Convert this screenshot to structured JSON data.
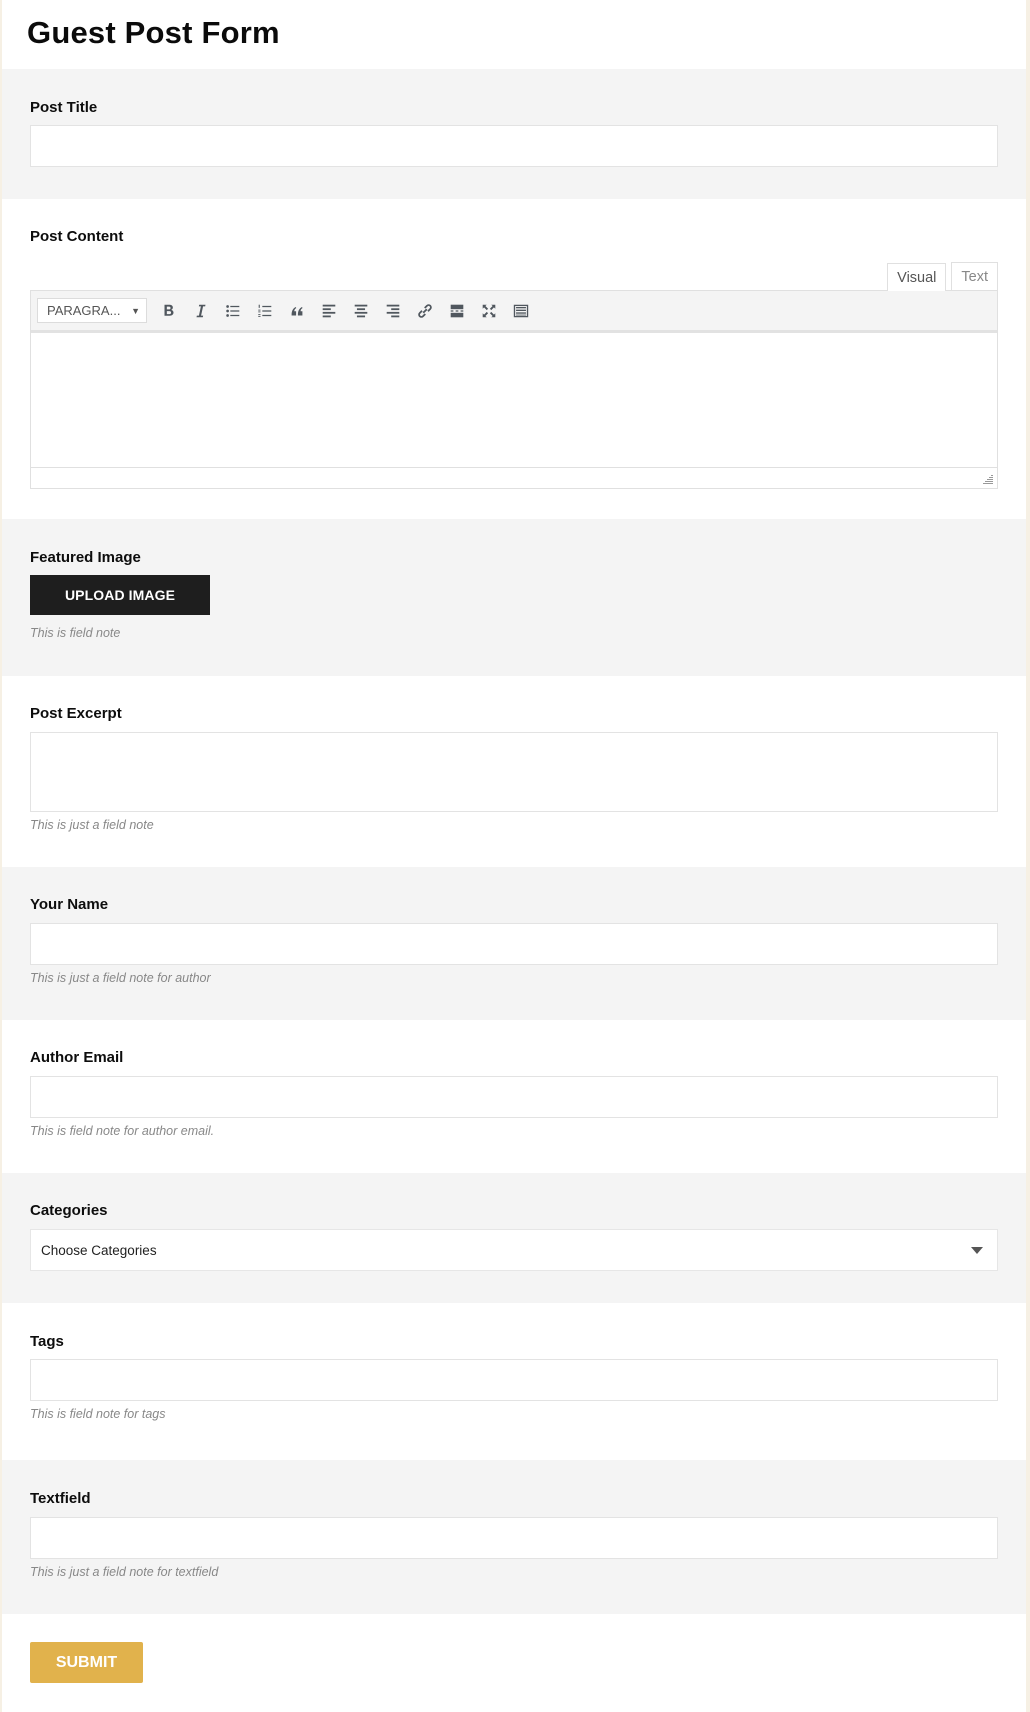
{
  "page": {
    "title": "Guest Post Form"
  },
  "colors": {
    "submit_bg": "#e1b24c",
    "upload_bg": "#1e1e1e",
    "section_alt_bg": "#f4f4f4",
    "side_strip": "#f6f0e4"
  },
  "fields": {
    "post_title": {
      "label": "Post Title",
      "value": "",
      "placeholder": ""
    },
    "post_content": {
      "label": "Post Content",
      "tabs": [
        {
          "label": "Visual",
          "active": true
        },
        {
          "label": "Text",
          "active": false
        }
      ],
      "format_select": "PARAGRA...",
      "toolbar_icons": [
        "bold-icon",
        "italic-icon",
        "bulleted-list-icon",
        "numbered-list-icon",
        "blockquote-icon",
        "align-left-icon",
        "align-center-icon",
        "align-right-icon",
        "link-icon",
        "read-more-icon",
        "fullscreen-icon",
        "toolbar-toggle-icon"
      ],
      "value": ""
    },
    "featured_image": {
      "label": "Featured Image",
      "button": "UPLOAD IMAGE",
      "note": "This is field note"
    },
    "post_excerpt": {
      "label": "Post Excerpt",
      "value": "",
      "note": "This is just a field note"
    },
    "your_name": {
      "label": "Your Name",
      "value": "",
      "note": "This is just a field note for author"
    },
    "author_email": {
      "label": "Author Email",
      "value": "",
      "note": "This is field note for author email."
    },
    "categories": {
      "label": "Categories",
      "selected": "Choose Categories"
    },
    "tags": {
      "label": "Tags",
      "value": "",
      "note": "This is field note for tags"
    },
    "textfield": {
      "label": "Textfield",
      "value": "",
      "note": "This is just a field note for textfield"
    }
  },
  "submit": {
    "label": "SUBMIT"
  }
}
